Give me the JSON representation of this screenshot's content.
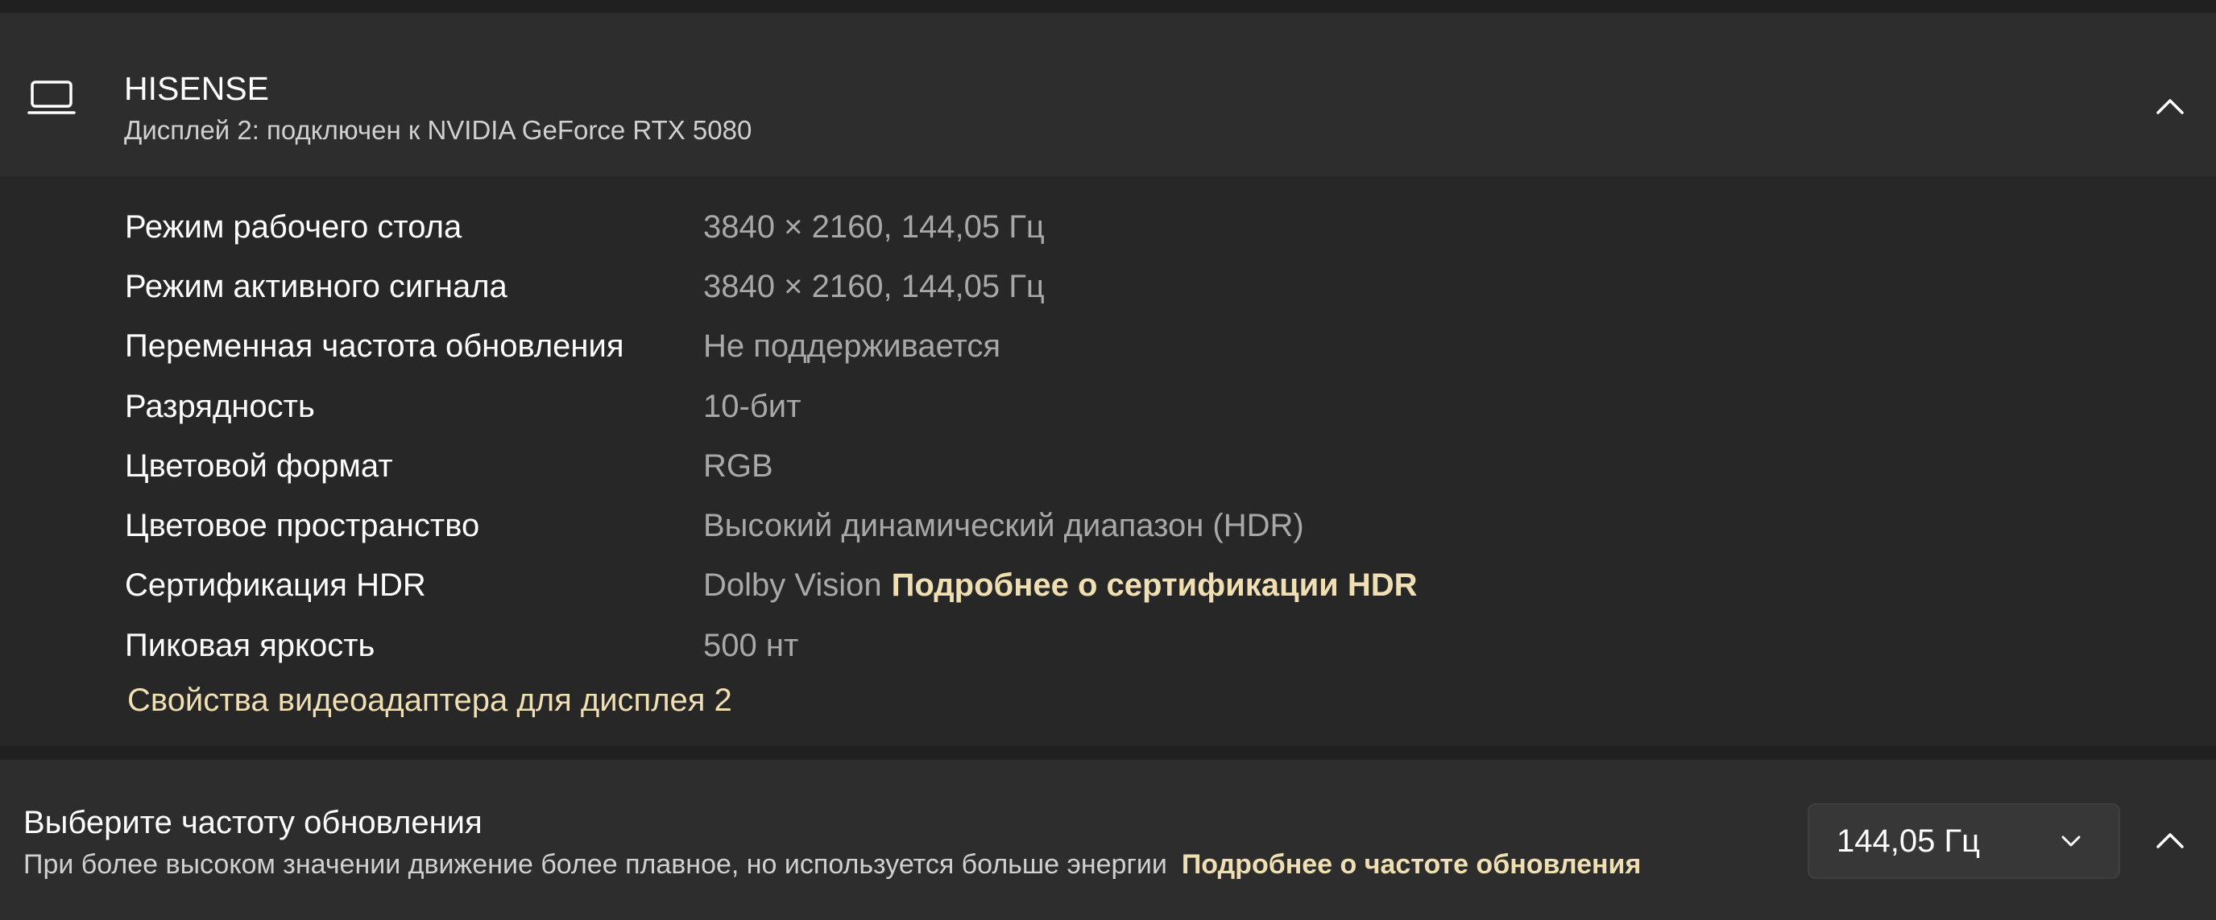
{
  "display": {
    "name": "HISENSE",
    "subtitle": "Дисплей 2: подключен к NVIDIA GeForce RTX 5080",
    "icon": "monitor-icon",
    "collapse_icon": "chevron-up-icon"
  },
  "details": {
    "rows": [
      {
        "label": "Режим рабочего стола",
        "value": "3840 × 2160, 144,05 Гц"
      },
      {
        "label": "Режим активного сигнала",
        "value": "3840 × 2160, 144,05 Гц"
      },
      {
        "label": "Переменная частота обновления",
        "value": "Не поддерживается"
      },
      {
        "label": "Разрядность",
        "value": "10-бит"
      },
      {
        "label": "Цветовой формат",
        "value": "RGB"
      },
      {
        "label": "Цветовое пространство",
        "value": "Высокий динамический диапазон (HDR)"
      },
      {
        "label": "Сертификация HDR",
        "value": "Dolby Vision",
        "link": "Подробнее о сертификации HDR"
      },
      {
        "label": "Пиковая яркость",
        "value": "500 нт"
      }
    ],
    "adapter_link": "Свойства видеоадаптера для дисплея 2"
  },
  "refresh": {
    "title": "Выберите частоту обновления",
    "description": "При более высоком значении движение более плавное, но используется больше энергии",
    "link": "Подробнее о частоте обновления",
    "selected": "144,05 Гц",
    "dropdown_icon": "chevron-down-icon",
    "collapse_icon": "chevron-up-icon"
  },
  "colors": {
    "accent_link": "#f0dfb2",
    "background": "#202020",
    "card": "#2d2d2d",
    "panel": "#272727"
  }
}
